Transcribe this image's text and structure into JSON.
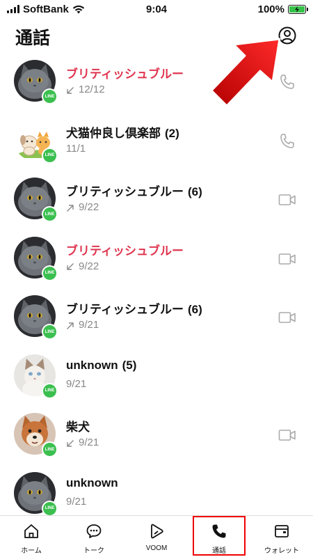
{
  "status_bar": {
    "carrier": "SoftBank",
    "time": "9:04",
    "battery": "100%"
  },
  "header": {
    "title": "通話",
    "profile_icon": "profile-circle-icon"
  },
  "colors": {
    "missed": "#e0354f",
    "line_green": "#3bbf4f",
    "highlight_red": "#e00000",
    "arrow_red": "#e01010"
  },
  "calls": [
    {
      "name": "ブリティッシュブルー",
      "count": "",
      "date": "12/12",
      "direction": "incoming",
      "missed": true,
      "avatar": "gray-cat",
      "action": "phone-icon"
    },
    {
      "name": "犬猫仲良し倶楽部",
      "count": "(2)",
      "date": "11/1",
      "direction": "none",
      "missed": false,
      "avatar": "dog-cat-illustration",
      "action": "phone-icon"
    },
    {
      "name": "ブリティッシュブルー",
      "count": "(6)",
      "date": "9/22",
      "direction": "outgoing",
      "missed": false,
      "avatar": "gray-cat",
      "action": "video-icon"
    },
    {
      "name": "ブリティッシュブルー",
      "count": "",
      "date": "9/22",
      "direction": "incoming",
      "missed": true,
      "avatar": "gray-cat",
      "action": "video-icon"
    },
    {
      "name": "ブリティッシュブルー",
      "count": "(6)",
      "date": "9/21",
      "direction": "outgoing",
      "missed": false,
      "avatar": "gray-cat",
      "action": "video-icon"
    },
    {
      "name": "unknown",
      "count": "(5)",
      "date": "9/21",
      "direction": "none",
      "missed": false,
      "avatar": "white-cat",
      "action": "none"
    },
    {
      "name": "柴犬",
      "count": "",
      "date": "9/21",
      "direction": "incoming",
      "missed": false,
      "avatar": "shiba-dog",
      "action": "video-icon"
    },
    {
      "name": "unknown",
      "count": "",
      "date": "9/21",
      "direction": "none",
      "missed": false,
      "avatar": "gray-cat",
      "action": "none"
    }
  ],
  "badge_text": "LINE",
  "tabs": [
    {
      "label": "ホーム",
      "icon": "home-icon",
      "active": false
    },
    {
      "label": "トーク",
      "icon": "chat-bubble-icon",
      "active": false
    },
    {
      "label": "VOOM",
      "icon": "voom-play-icon",
      "active": false
    },
    {
      "label": "通話",
      "icon": "phone-icon",
      "active": true
    },
    {
      "label": "ウォレット",
      "icon": "wallet-icon",
      "active": false
    }
  ]
}
